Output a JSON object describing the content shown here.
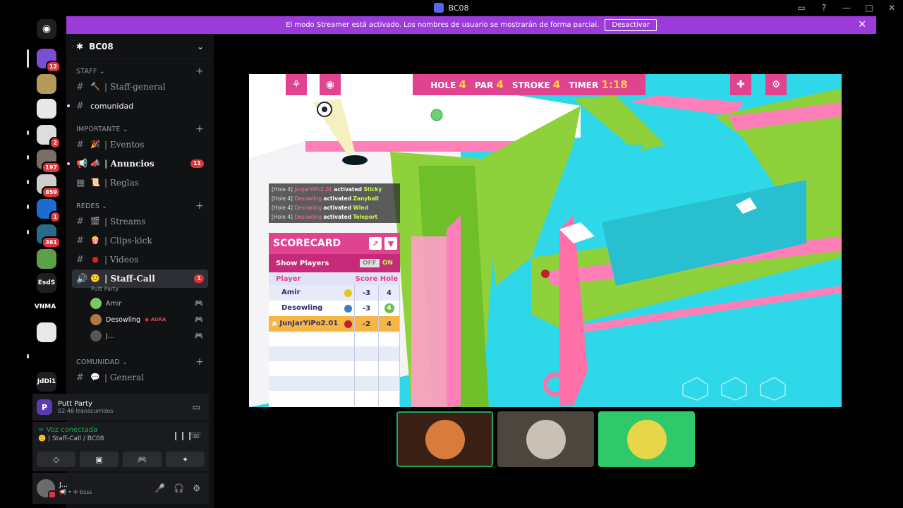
{
  "window": {
    "title": "BC08",
    "controls": [
      "▭",
      "?",
      "—",
      "□",
      "✕"
    ]
  },
  "banner": {
    "text": "El modo Streamer está activado. Los nombres de usuario se mostrarán de forma parcial.",
    "button": "Desactivar"
  },
  "rail": {
    "labels": {
      "esds": "EsdS",
      "vnma": "VNMA",
      "jddi": "JdDi1"
    },
    "badges": {
      "s1": "12",
      "s4": "2",
      "s5": "197",
      "s6": "859",
      "s7": "1",
      "s8": "361"
    }
  },
  "guild": {
    "name": "BC08"
  },
  "categories": {
    "staff": "STAFF",
    "importante": "IMPORTANTE",
    "redes": "REDES",
    "comunidad": "COMUNIDAD"
  },
  "channels": {
    "staff_general": "| Staff-general",
    "comunidad": "comunidad",
    "eventos": "| Eventos",
    "anuncios": "| Anuncios",
    "anuncios_count": "11",
    "reglas": "| Reglas",
    "streams": "| Streams",
    "clips": "| Clips-kick",
    "videos": "| Videos",
    "staff_call": "| Staff-Call",
    "staff_call_count": "1",
    "staff_call_activity": "Putt Party",
    "general": "| General"
  },
  "voice_users": [
    {
      "name": "Amir",
      "color": "#7fc36b"
    },
    {
      "name": "Desowling",
      "color": "#b07844",
      "tag": "AURA"
    },
    {
      "name": "J...",
      "color": "#555555"
    }
  ],
  "activity": {
    "name": "Putt Party",
    "elapsed": "02:46 transcurridos"
  },
  "voice": {
    "status": "Voz conectada",
    "location": "| Staff-Call / BC08"
  },
  "user": {
    "name": "J...",
    "status": "bsss"
  },
  "game": {
    "hud": {
      "hole_label": "HOLE",
      "hole": "4",
      "par_label": "PAR",
      "par": "4",
      "stroke_label": "STROKE",
      "stroke": "4",
      "timer_label": "TIMER",
      "timer": "1:18"
    },
    "feed": [
      {
        "hole": "[Hole 4]",
        "player": "JunJarYiPo2.01",
        "action": "activated",
        "power": "Sticky"
      },
      {
        "hole": "[Hole 4]",
        "player": "Desowling",
        "action": "activated",
        "power": "Zanyball"
      },
      {
        "hole": "[Hole 4]",
        "player": "Desowling",
        "action": "activated",
        "power": "Wind"
      },
      {
        "hole": "[Hole 4]",
        "player": "Desowling",
        "action": "activated",
        "power": "Teleport"
      }
    ],
    "scorecard": {
      "title": "SCORECARD",
      "show_players": "Show Players",
      "off": "OFF",
      "on": "ON",
      "headers": {
        "player": "Player",
        "score": "Score",
        "hole": "Hole"
      },
      "rows": [
        {
          "player": "Amir",
          "score": "-3",
          "hole": "4",
          "ball": "#e8c51c"
        },
        {
          "player": "Desowling",
          "score": "-3",
          "hole": "4",
          "ball": "#3a7fc0"
        },
        {
          "player": "JunJarYiPo2.01",
          "score": "-2",
          "hole": "4",
          "ball": "#c0202e"
        }
      ]
    }
  },
  "colors": {
    "accent": "#9b3bd9",
    "game_pink": "#e0438f",
    "water": "#2fd8e8",
    "grass": "#8fd13a"
  }
}
